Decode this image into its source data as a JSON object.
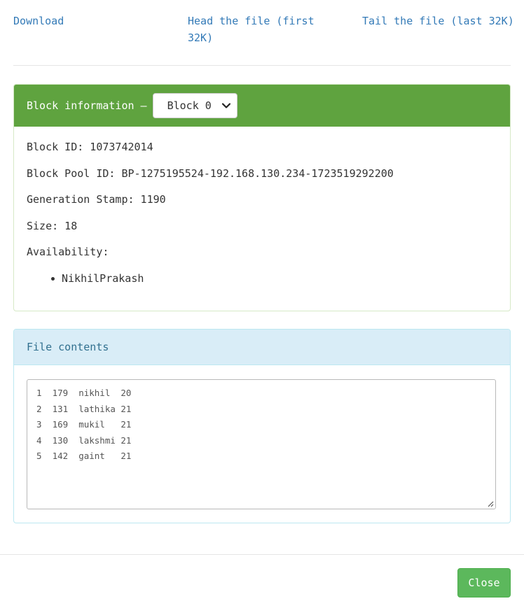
{
  "links": {
    "download": "Download",
    "head": "Head the file (first 32K)",
    "tail": "Tail the file (last 32K)"
  },
  "block_panel": {
    "heading": "Block information —",
    "selected_block": "Block 0",
    "block_id": "Block ID: 1073742014",
    "block_pool_id": "Block Pool ID: BP-1275195524-192.168.130.234-1723519292200",
    "generation_stamp": "Generation Stamp: 1190",
    "size": "Size: 18",
    "availability_label": "Availability:",
    "availability": [
      "NikhilPrakash"
    ]
  },
  "file_panel": {
    "heading": "File contents",
    "lines": [
      "1  179  nikhil  20",
      "2  131  lathika 21",
      "3  169  mukil   21",
      "4  130  lakshmi 21",
      "5  142  gaint   21"
    ]
  },
  "footer": {
    "close_label": "Close"
  },
  "colors": {
    "link": "#337ab7",
    "success_heading": "#5fa33f",
    "info_heading_bg": "#d9edf7",
    "info_heading_text": "#31708f",
    "close_button": "#5cb85c"
  },
  "icons": {
    "select_arrow": "chevron-down-icon",
    "textarea_resize": "resize-grip-icon"
  }
}
